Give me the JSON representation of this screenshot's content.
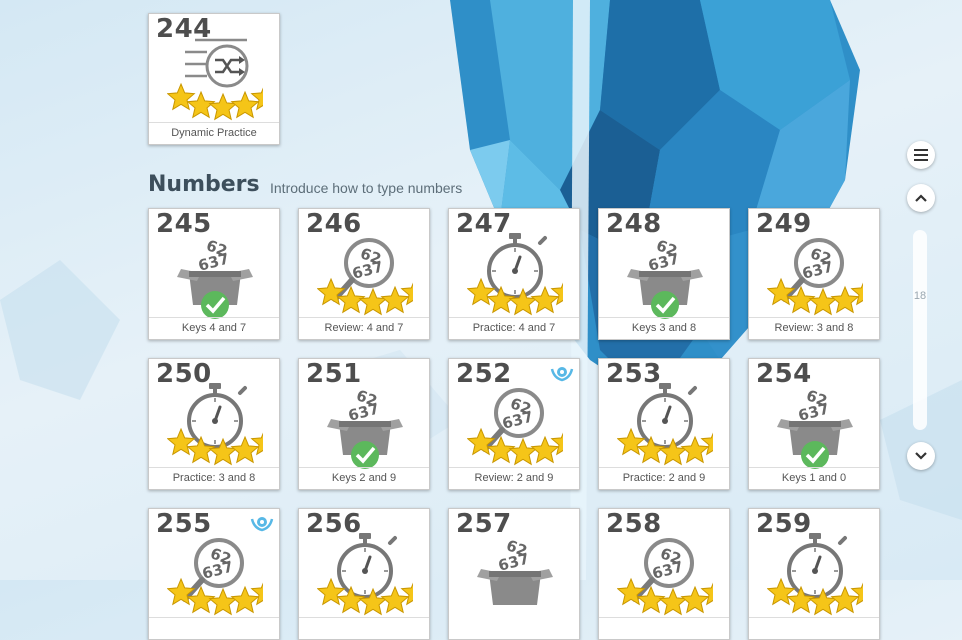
{
  "top_lesson": {
    "number": "244",
    "label": "Dynamic Practice",
    "icon": "shuffle-list-icon",
    "status": "stars",
    "badge": false
  },
  "section": {
    "title": "Numbers",
    "subtitle": "Introduce how to type numbers"
  },
  "lessons": [
    {
      "number": "245",
      "label": "Keys 4 and 7",
      "icon": "number-box-icon",
      "status": "check",
      "badge": false
    },
    {
      "number": "246",
      "label": "Review: 4 and 7",
      "icon": "magnifier-numbers-icon",
      "status": "stars",
      "badge": false
    },
    {
      "number": "247",
      "label": "Practice: 4 and 7",
      "icon": "stopwatch-icon",
      "status": "stars",
      "badge": false
    },
    {
      "number": "248",
      "label": "Keys 3 and 8",
      "icon": "number-box-icon",
      "status": "check",
      "badge": false
    },
    {
      "number": "249",
      "label": "Review: 3 and 8",
      "icon": "magnifier-numbers-icon",
      "status": "stars",
      "badge": false
    },
    {
      "number": "250",
      "label": "Practice: 3 and 8",
      "icon": "stopwatch-icon",
      "status": "stars",
      "badge": false
    },
    {
      "number": "251",
      "label": "Keys 2 and 9",
      "icon": "number-box-icon",
      "status": "check",
      "badge": false
    },
    {
      "number": "252",
      "label": "Review: 2 and 9",
      "icon": "magnifier-numbers-icon",
      "status": "stars",
      "badge": true
    },
    {
      "number": "253",
      "label": "Practice: 2 and 9",
      "icon": "stopwatch-icon",
      "status": "stars",
      "badge": false
    },
    {
      "number": "254",
      "label": "Keys 1 and 0",
      "icon": "number-box-icon",
      "status": "check",
      "badge": false
    },
    {
      "number": "255",
      "label": "",
      "icon": "magnifier-numbers-icon",
      "status": "stars",
      "badge": true
    },
    {
      "number": "256",
      "label": "",
      "icon": "stopwatch-icon",
      "status": "stars",
      "badge": false
    },
    {
      "number": "257",
      "label": "",
      "icon": "number-box-icon",
      "status": "none",
      "badge": false
    },
    {
      "number": "258",
      "label": "",
      "icon": "magnifier-numbers-icon",
      "status": "stars",
      "badge": false
    },
    {
      "number": "259",
      "label": "",
      "icon": "stopwatch-icon",
      "status": "stars",
      "badge": false
    }
  ],
  "controls": {
    "menu_icon": "menu-icon",
    "up_icon": "chevron-up-icon",
    "down_icon": "chevron-down-icon",
    "scroll_label": "18"
  },
  "colors": {
    "star": "#f5c518",
    "check": "#5cb85c",
    "number_text": "#4e4e4e",
    "badge": "#57b8e6"
  }
}
